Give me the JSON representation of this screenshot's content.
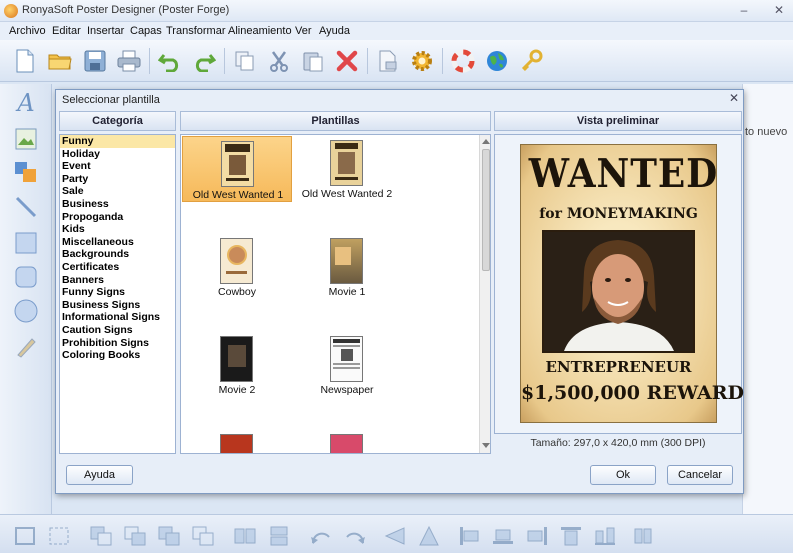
{
  "window": {
    "title": "RonyaSoft Poster Designer (Poster Forge)"
  },
  "menu": [
    "Archivo",
    "Editar",
    "Insertar",
    "Capas",
    "Transformar",
    "Alineamiento",
    "Ver",
    "Ayuda"
  ],
  "right_panel": {
    "text": "to nuevo"
  },
  "dialog": {
    "title": "Seleccionar plantilla",
    "headers": {
      "category": "Categoría",
      "templates": "Plantillas",
      "preview": "Vista preliminar"
    },
    "categories": [
      "Funny",
      "Holiday",
      "Event",
      "Party",
      "Sale",
      "Business",
      "Propoganda",
      "Kids",
      "Miscellaneous",
      "Backgrounds",
      "Certificates",
      "Banners",
      "Funny Signs",
      "Business Signs",
      "Informational Signs",
      "Caution Signs",
      "Prohibition Signs",
      "Coloring Books"
    ],
    "selected_category": "Funny",
    "templates": [
      "Old West Wanted 1",
      "Old West Wanted 2",
      "Cowboy",
      "Movie 1",
      "Movie 2",
      "Newspaper"
    ],
    "selected_template": "Old West Wanted 1",
    "preview": {
      "headline": "WANTED",
      "subline": "for MONEYMAKING",
      "occupation": "ENTREPRENEUR",
      "reward": "$1,500,000 REWARD"
    },
    "size_text": "Tamaño: 297,0 x 420,0 mm (300 DPI)",
    "buttons": {
      "help": "Ayuda",
      "ok": "Ok",
      "cancel": "Cancelar"
    }
  },
  "colors": {
    "selection": "#fbe7a6",
    "accent": "#f6b95a",
    "panel": "#e7eef8"
  }
}
